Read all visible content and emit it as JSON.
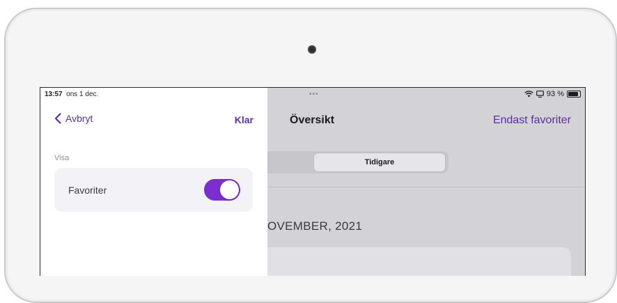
{
  "status": {
    "time": "13:57",
    "date": "ons 1 dec.",
    "battery": "93 %",
    "multitask": "•••"
  },
  "panel": {
    "back_label": "Avbryt",
    "done_label": "Klar",
    "section_label": "Visa",
    "favorites_label": "Favoriter",
    "favorites_on": true
  },
  "main": {
    "title": "Översikt",
    "right_action": "Endast favoriter",
    "segment_label": "Tidigare",
    "section_header": "OVEMBER, 2021"
  },
  "colors": {
    "accent": "#5b2fa0",
    "toggle_on": "#7b2fd1"
  }
}
